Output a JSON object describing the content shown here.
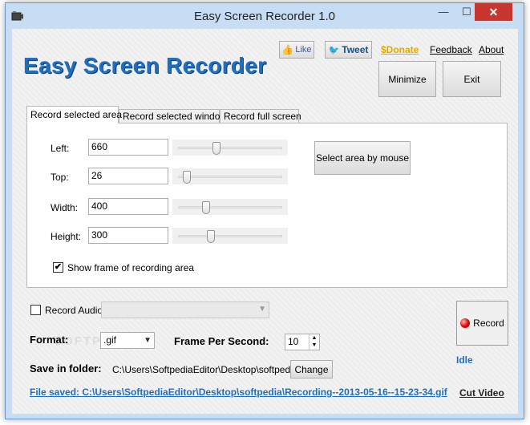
{
  "window": {
    "title": "Easy Screen Recorder 1.0",
    "controls": {
      "minimize": "—",
      "maximize": "☐",
      "close": "✕"
    }
  },
  "header": {
    "logo_text": "Easy Screen Recorder",
    "like_label": "Like",
    "tweet_label": "Tweet",
    "donate_label": "$Donate",
    "feedback_label": "Feedback",
    "about_label": "About",
    "minimize_label": "Minimize",
    "exit_label": "Exit"
  },
  "tabs": [
    {
      "label": "Record selected area",
      "active": true
    },
    {
      "label": "Record selected window",
      "active": false
    },
    {
      "label": "Record full screen",
      "active": false
    }
  ],
  "area": {
    "fields": [
      {
        "label": "Left:",
        "value": "660",
        "slider": 0.36
      },
      {
        "label": "Top:",
        "value": "26",
        "slider": 0.05
      },
      {
        "label": "Width:",
        "value": "400",
        "slider": 0.25
      },
      {
        "label": "Height:",
        "value": "300",
        "slider": 0.3
      }
    ],
    "select_button": "Select area by mouse",
    "show_frame_label": "Show frame of recording area",
    "show_frame_checked": true
  },
  "audio": {
    "label": "Record Audio",
    "checked": false,
    "device": ""
  },
  "record": {
    "label": "Record",
    "status": "Idle"
  },
  "format": {
    "label": "Format:",
    "value": ".gif"
  },
  "fps": {
    "label": "Frame Per Second:",
    "value": "10"
  },
  "save": {
    "label": "Save in folder:",
    "path": "C:\\Users\\SoftpediaEditor\\Desktop\\softpedia",
    "change_label": "Change",
    "saved_text": "File saved: C:\\Users\\SoftpediaEditor\\Desktop\\softpedia\\Recording--2013-05-16--15-23-34.gif",
    "cut_video_label": "Cut Video"
  },
  "watermark": "SOFTPEDIA",
  "colors": {
    "accent": "#1f6fc0",
    "close": "#c7372f",
    "donate": "#e6a800"
  }
}
